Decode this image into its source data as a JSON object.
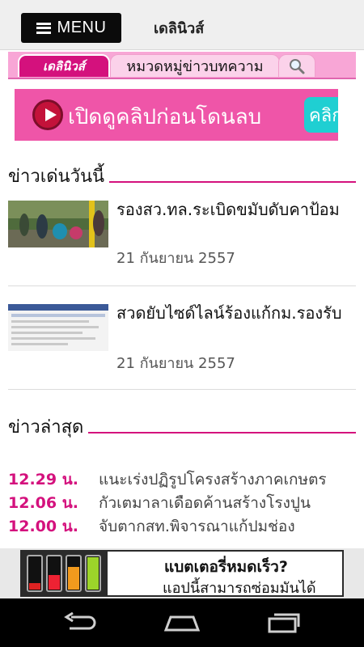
{
  "topbar": {
    "menu_label": "MENU",
    "app_title": "เดลินิวส์"
  },
  "tabs": {
    "logo_text": "เดลินิวส์",
    "category_label": "หมวดหมู่ข่าวบทความ",
    "search_icon": "search-icon"
  },
  "banner": {
    "text": "เปิดดูคลิปก่อนโดนลบ",
    "cta": "คลิก"
  },
  "featured": {
    "heading": "ข่าวเด่นวันนี้",
    "items": [
      {
        "title": "รองสว.ทล.ระเบิดขมับดับคาป้อม",
        "date": "21 กันยายน 2557"
      },
      {
        "title": "สวดยับไซด์ไลน์ร้องแก้กม.รองรับ",
        "date": "21 กันยายน 2557"
      }
    ]
  },
  "latest": {
    "heading": "ข่าวล่าสุด",
    "items": [
      {
        "time": "12.29 น.",
        "title": "แนะเร่งปฏิรูปโครงสร้างภาคเกษตร"
      },
      {
        "time": "12.06 น.",
        "title": "กัวเตมาลาเดือดค้านสร้างโรงปูน"
      },
      {
        "time": "12.00 น.",
        "title": "จับตากสท.พิจารณาแก้ปมช่อง"
      }
    ]
  },
  "ad": {
    "headline": "แบตเตอรี่หมดเร็ว?",
    "subtext": "แอปนี้สามารถซ่อมมันได้"
  },
  "colors": {
    "accent": "#d4117d",
    "tab_bg": "#f8a6d6",
    "banner_bg": "#ef55a8"
  }
}
